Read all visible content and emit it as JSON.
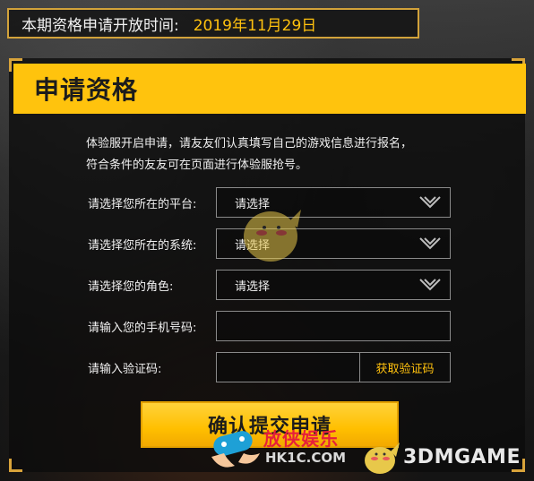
{
  "time_bar": {
    "label": "本期资格申请开放时间:",
    "date": "2019年11月29日"
  },
  "panel": {
    "title": "申请资格",
    "description_line1": "体验服开启申请，请友友们认真填写自己的游戏信息进行报名，",
    "description_line2": "符合条件的友友可在页面进行体验服抢号。"
  },
  "form": {
    "platform": {
      "label": "请选择您所在的平台:",
      "value": "请选择"
    },
    "system": {
      "label": "请选择您所在的系统:",
      "value": "请选择"
    },
    "role": {
      "label": "请选择您的角色:",
      "value": "请选择"
    },
    "phone": {
      "label": "请输入您的手机号码:",
      "value": ""
    },
    "code": {
      "label": "请输入验证码:",
      "value": "",
      "button": "获取验证码"
    },
    "submit": "确认提交申请"
  },
  "watermarks": {
    "hk_cn": "放侠娱乐",
    "hk_en": "HK1C.COM",
    "dm": "3DMGAME"
  },
  "colors": {
    "accent": "#ffc30d",
    "date": "#ffc10e",
    "frame": "#d8a33a"
  }
}
